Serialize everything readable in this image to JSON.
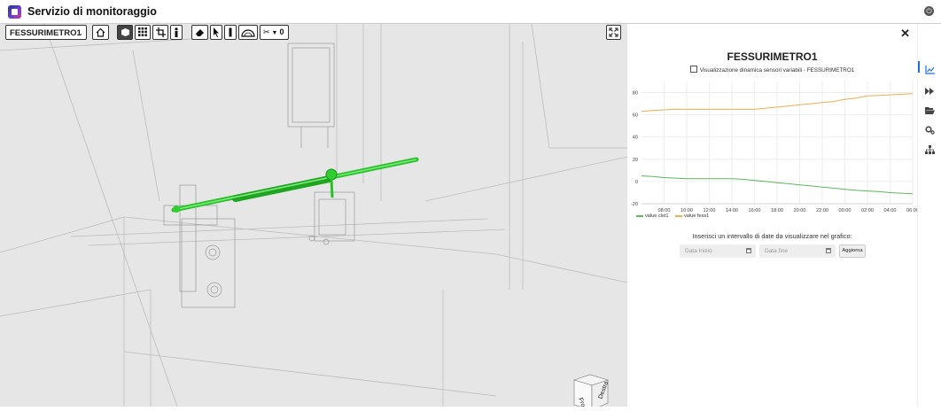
{
  "app": {
    "title": "Servizio di monitoraggio"
  },
  "toolbar": {
    "sensor_select": "FESSURIMETRO1",
    "measure_count": "0"
  },
  "viewcube": {
    "face_front": "Fronte",
    "face_right": "Destra"
  },
  "panel": {
    "title": "FESSURIMETRO1",
    "subtitle": "Visualizzazione dinamica sensori variabili - FESSURIMETRO1",
    "date_prompt": "Inserisci un intervallo di date da visualizzare nel grafico:",
    "start_placeholder": "Data Inizio",
    "end_placeholder": "Data fine",
    "update_label": "Aggiorna"
  },
  "chart_data": {
    "type": "line",
    "x": [
      "06:00",
      "07:00",
      "08:00",
      "09:00",
      "10:00",
      "11:00",
      "12:00",
      "13:00",
      "14:00",
      "15:00",
      "16:00",
      "17:00",
      "18:00",
      "19:00",
      "20:00",
      "21:00",
      "22:00",
      "23:00",
      "00:00",
      "01:00",
      "02:00",
      "03:00",
      "04:00",
      "05:00",
      "06:00"
    ],
    "x_ticks": [
      "08:00",
      "10:00",
      "12:00",
      "14:00",
      "16:00",
      "18:00",
      "20:00",
      "22:00",
      "00:00",
      "02:00",
      "04:00",
      "06:00"
    ],
    "series": [
      {
        "name": "value clst1",
        "color": "#5cb85c",
        "values": [
          5,
          4.5,
          3.5,
          3,
          2.5,
          2.5,
          2.5,
          2.5,
          2.5,
          2,
          1,
          0,
          -1,
          -2,
          -3,
          -4,
          -5,
          -6,
          -7,
          -8,
          -8.5,
          -9,
          -10,
          -10.5,
          -11
        ]
      },
      {
        "name": "value fess1",
        "color": "#f0ad4e",
        "values": [
          63,
          64,
          64.5,
          65,
          65,
          65,
          65,
          65,
          65,
          65,
          65,
          66,
          67,
          68,
          69,
          70,
          71,
          72,
          74,
          75,
          77,
          77.5,
          78,
          78.5,
          79
        ]
      }
    ],
    "ylim": [
      -20,
      90
    ],
    "y_ticks": [
      -20,
      0,
      20,
      40,
      60,
      80
    ],
    "grid": true,
    "legend": "bottom-left"
  },
  "rail": {
    "icons": [
      "chart-line-icon",
      "forward-icon",
      "folder-open-icon",
      "cogs-icon",
      "sitemap-icon"
    ]
  }
}
